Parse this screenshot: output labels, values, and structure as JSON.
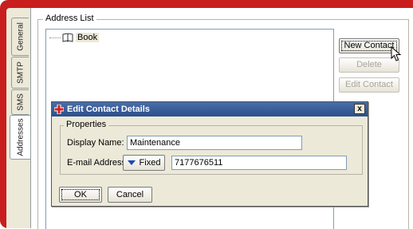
{
  "tabs": [
    {
      "label": "General"
    },
    {
      "label": "SMTP"
    },
    {
      "label": "SMS"
    },
    {
      "label": "Addresses"
    }
  ],
  "address_list": {
    "title": "Address List",
    "items": [
      {
        "label": "Book"
      }
    ]
  },
  "buttons": {
    "new_contact": "New Contact",
    "delete": "Delete",
    "edit_contact": "Edit Contact"
  },
  "dialog": {
    "title": "Edit Contact Details",
    "close": "x",
    "properties_title": "Properties",
    "display_name_label": "Display Name:",
    "display_name_value": "Maintenance",
    "email_label": "E-mail Address:",
    "email_mode": "Fixed",
    "email_value": "7177676511",
    "ok": "OK",
    "cancel": "Cancel"
  },
  "colors": {
    "frame": "#c81e1e",
    "titlebar": "#2b4f8c",
    "window": "#ece9d8"
  }
}
